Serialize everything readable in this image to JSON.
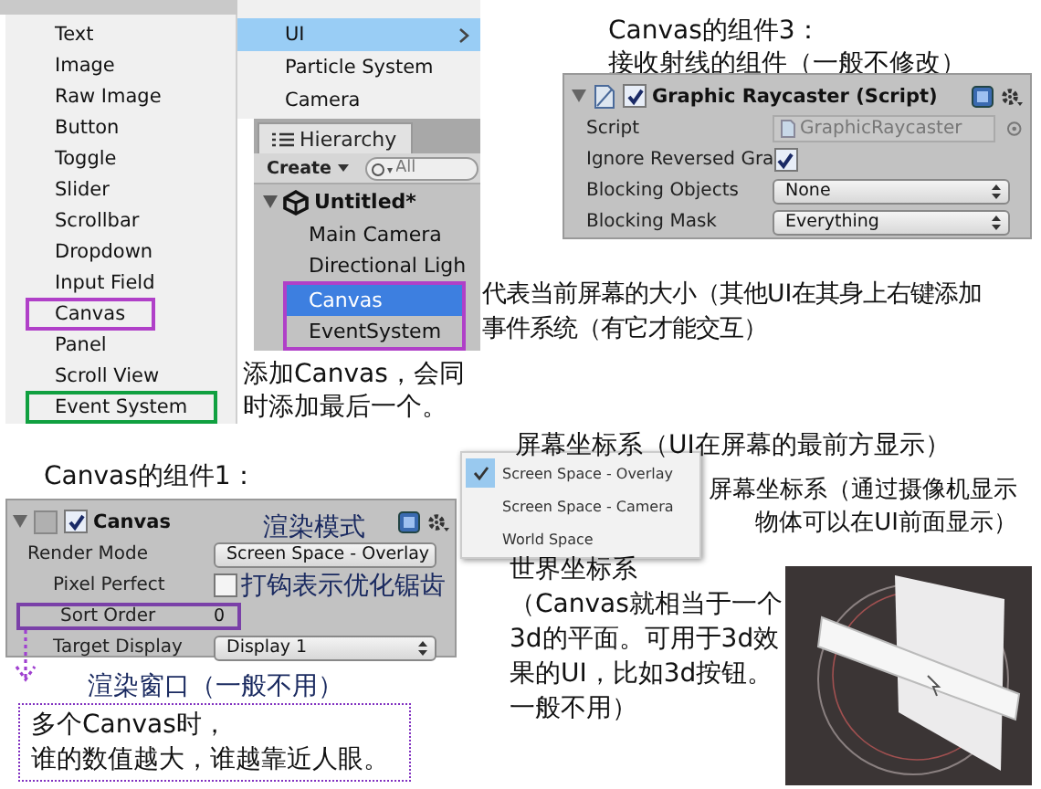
{
  "ui_menu": {
    "items": [
      {
        "label": "Text"
      },
      {
        "label": "Image"
      },
      {
        "label": "Raw Image"
      },
      {
        "label": "Button"
      },
      {
        "label": "Toggle"
      },
      {
        "label": "Slider"
      },
      {
        "label": "Scrollbar"
      },
      {
        "label": "Dropdown"
      },
      {
        "label": "Input Field"
      },
      {
        "label": "Canvas",
        "color": "#b040c8"
      },
      {
        "label": "Panel"
      },
      {
        "label": "Scroll View"
      },
      {
        "label": "Event System",
        "color": "#10a040"
      }
    ]
  },
  "create_menu": {
    "items": [
      {
        "label": "UI",
        "selected": true,
        "has_submenu": true
      },
      {
        "label": "Particle System",
        "selected": false,
        "has_submenu": false
      },
      {
        "label": "Camera",
        "selected": false,
        "has_submenu": false
      }
    ]
  },
  "hierarchy": {
    "tab": "Hierarchy",
    "create_button": "Create",
    "search_placeholder": "All",
    "scene": "Untitled*",
    "items": [
      {
        "label": "Main Camera",
        "selected": false,
        "framed": false
      },
      {
        "label": "Directional Ligh",
        "selected": false,
        "framed": false
      },
      {
        "label": "Canvas",
        "selected": true,
        "framed": true
      },
      {
        "label": "EventSystem",
        "selected": false,
        "framed": true
      }
    ]
  },
  "hierarchy_note": [
    "代表当前屏幕的大小（其他UI在其身上右键添加",
    "事件系统（有它才能交互）"
  ],
  "add_note": [
    "添加Canvas，会同",
    "时添加最后一个。"
  ],
  "component3_note": [
    "Canvas的组件3：",
    "接收射线的组件（一般不修改）"
  ],
  "raycaster": {
    "title": "Graphic Raycaster (Script)",
    "enabled": true,
    "expanded": true,
    "rows": [
      {
        "kind": "object",
        "label": "Script",
        "value": "GraphicRaycaster"
      },
      {
        "kind": "toggle",
        "label": "Ignore Reversed Gra",
        "checked": true
      },
      {
        "kind": "dropdown",
        "label": "Blocking Objects",
        "value": "None"
      },
      {
        "kind": "dropdown",
        "label": "Blocking Mask",
        "value": "Everything"
      }
    ]
  },
  "component1_note": "Canvas的组件1：",
  "canvas": {
    "title": "Canvas",
    "enabled": true,
    "expanded": true,
    "header_note": "渲染模式",
    "rows": [
      {
        "kind": "dropdown",
        "label": "Render Mode",
        "value": "Screen Space - Overlay",
        "indented": false,
        "framed": false
      },
      {
        "kind": "toggle",
        "label": "Pixel Perfect",
        "checked": false,
        "indented": true,
        "framed": false,
        "note": "打钩表示优化锯齿"
      },
      {
        "kind": "number",
        "label": "Sort Order",
        "value": "0",
        "indented": true,
        "framed": true
      },
      {
        "kind": "dropdown",
        "label": "Target Display",
        "value": "Display 1",
        "indented": true,
        "framed": false
      }
    ]
  },
  "render_window_note": "渲染窗口（一般不用）",
  "sort_note": [
    "多个Canvas时，",
    "谁的数值越大，谁越靠近人眼。"
  ],
  "render_mode_popup": {
    "items": [
      {
        "label": "Screen Space - Overlay",
        "selected": true
      },
      {
        "label": "Screen Space - Camera",
        "selected": false
      },
      {
        "label": "World Space",
        "selected": false
      }
    ]
  },
  "overlay_note": "屏幕坐标系（UI在屏幕的最前方显示）",
  "camera_note": [
    "屏幕坐标系（通过摄像机显示",
    "物体可以在UI前面显示）"
  ],
  "world_note": [
    "世界坐标系",
    "（Canvas就相当于一个",
    "3d的平面。可用于3d效",
    "果的UI，比如3d按钮。",
    "一般不用）"
  ]
}
